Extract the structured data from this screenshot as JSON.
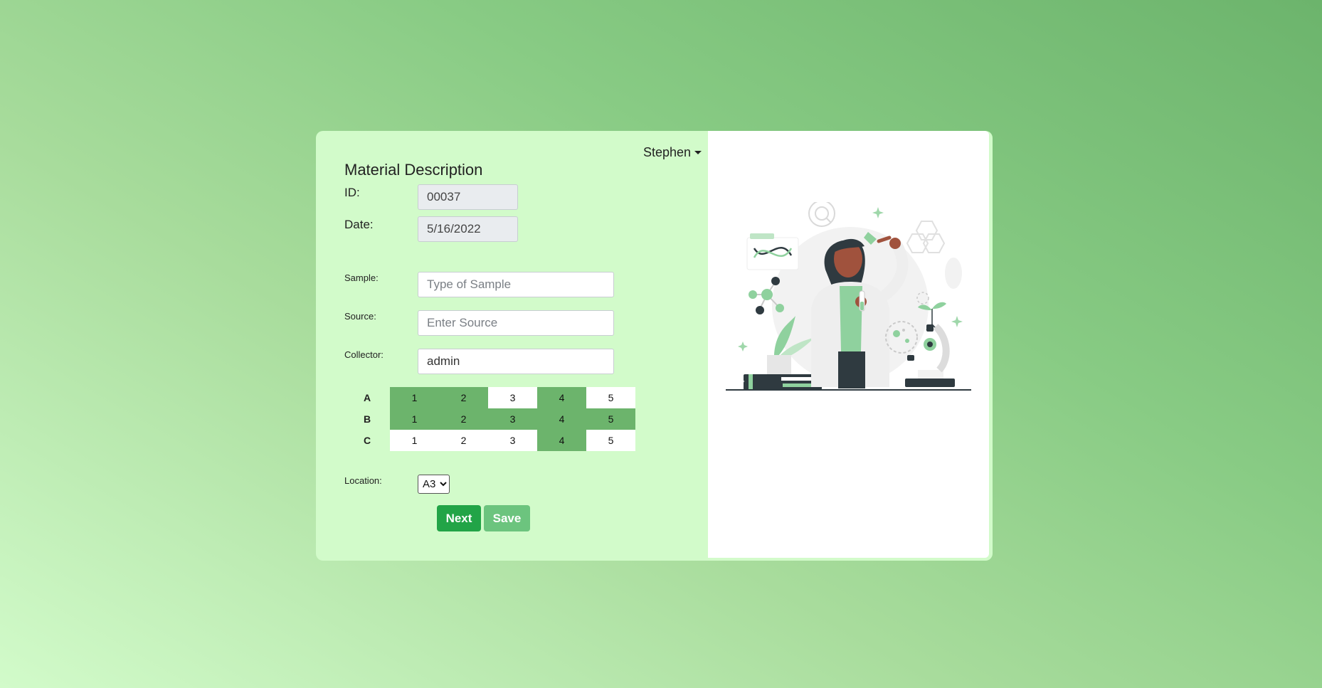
{
  "user_menu": {
    "name": "Stephen"
  },
  "form": {
    "title": "Material Description",
    "id_label": "ID:",
    "id_value": "00037",
    "date_label": "Date:",
    "date_value": "5/16/2022",
    "sample_label": "Sample:",
    "sample_placeholder": "Type of Sample",
    "source_label": "Source:",
    "source_placeholder": "Enter Source",
    "collector_label": "Collector:",
    "collector_value": "admin",
    "location_label": "Location:",
    "location_value": "A3"
  },
  "grid": {
    "rows": [
      {
        "label": "A",
        "cells": [
          {
            "value": "1",
            "filled": true
          },
          {
            "value": "2",
            "filled": true
          },
          {
            "value": "3",
            "filled": false
          },
          {
            "value": "4",
            "filled": true
          },
          {
            "value": "5",
            "filled": false
          }
        ]
      },
      {
        "label": "B",
        "cells": [
          {
            "value": "1",
            "filled": true
          },
          {
            "value": "2",
            "filled": true
          },
          {
            "value": "3",
            "filled": true
          },
          {
            "value": "4",
            "filled": true
          },
          {
            "value": "5",
            "filled": true
          }
        ]
      },
      {
        "label": "C",
        "cells": [
          {
            "value": "1",
            "filled": false
          },
          {
            "value": "2",
            "filled": false
          },
          {
            "value": "3",
            "filled": false
          },
          {
            "value": "4",
            "filled": true
          },
          {
            "value": "5",
            "filled": false
          }
        ]
      }
    ]
  },
  "buttons": {
    "next": "Next",
    "save": "Save"
  },
  "colors": {
    "panel": "#d2fbca",
    "filled_cell": "#6cb46c",
    "next_button": "#22a447",
    "save_button": "#6cc47e",
    "illustration_accent": "#8fd19e"
  },
  "illustration": {
    "icon": "scientist-lab-illustration"
  }
}
